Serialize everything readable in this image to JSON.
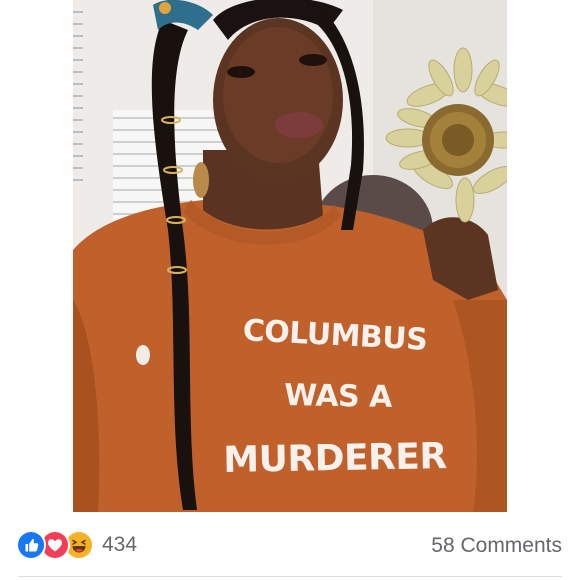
{
  "post": {
    "shirt_text": {
      "line1": "COLUMBUS",
      "line2": "WAS A",
      "line3": "MURDERER"
    }
  },
  "reactions": {
    "icons": [
      "like-icon",
      "love-icon",
      "haha-icon"
    ],
    "count": "434"
  },
  "comments": {
    "label": "58 Comments"
  },
  "colors": {
    "like": "#1877f2",
    "love": "#f33e58",
    "haha": "#f7b125",
    "meta_text": "#65676b",
    "sweatshirt": "#c0612b"
  }
}
